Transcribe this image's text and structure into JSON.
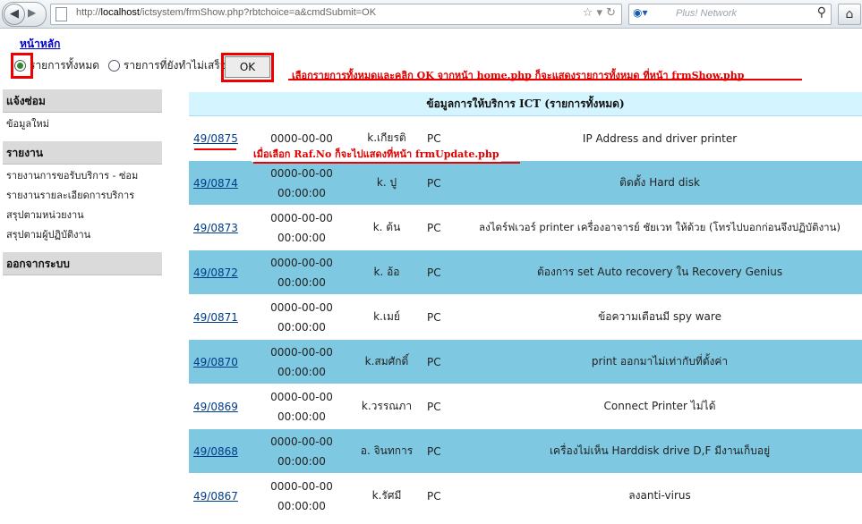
{
  "browser": {
    "url_prefix": "http://",
    "url_host": "localhost",
    "url_path": "/ictsystem/frmShow.php?rbtchoice=a&cmdSubmit=OK",
    "search_placeholder": "Plus! Network"
  },
  "header": {
    "home_link": "หน้าหลัก",
    "radio_all_label": "รายการทั้งหมด",
    "radio_pending_label": "รายการที่ยังทำไม่เสร็จ",
    "selected": "all",
    "ok_label": "OK"
  },
  "annotations": {
    "top_note": "เลือกรายการทั้งหมดและคลิก OK จากหน้า home.php ก็จะแสดงรายการทั้งหมด ที่หน้า frmShow.php",
    "ref_note": "เมื่อเลือก Raf.No ก็จะไปแสดงที่หน้า frmUpdate.php"
  },
  "sidebar": {
    "sections": [
      {
        "title": "แจ้งซ่อม",
        "items": [
          "ข้อมูลใหม่"
        ]
      },
      {
        "title": "รายงาน",
        "items": [
          "รายงานการขอรับบริการ - ซ่อม",
          "รายงานรายละเอียดการบริการ",
          "สรุปตามหน่วยงาน",
          "สรุปตามผู้ปฏิบัติงาน"
        ]
      },
      {
        "title": "ออกจากระบบ",
        "items": []
      }
    ]
  },
  "table": {
    "title": "ข้อมูลการให้บริการ ICT (รายการทั้งหมด)",
    "rows": [
      {
        "ref": "49/0875",
        "date": "0000-00-00",
        "time": "",
        "person": "k.เกียรติ",
        "cat": "PC",
        "desc": "IP Address and driver printer"
      },
      {
        "ref": "49/0874",
        "date": "0000-00-00",
        "time": "00:00:00",
        "person": "k. ปู",
        "cat": "PC",
        "desc": "ติดตั้ง Hard disk"
      },
      {
        "ref": "49/0873",
        "date": "0000-00-00",
        "time": "00:00:00",
        "person": "k. ต้น",
        "cat": "PC",
        "desc": "ลงไดร์ฟเวอร์ printer เครื่องอาจารย์ ชัยเวท ให้ด้วย (โทรไปบอกก่อนจึงปฏิบัติงาน)"
      },
      {
        "ref": "49/0872",
        "date": "0000-00-00",
        "time": "00:00:00",
        "person": "k. อ้อ",
        "cat": "PC",
        "desc": "ต้องการ set Auto recovery ใน Recovery Genius"
      },
      {
        "ref": "49/0871",
        "date": "0000-00-00",
        "time": "00:00:00",
        "person": "k.เมย์",
        "cat": "PC",
        "desc": "ข้อความเตือนมี spy ware"
      },
      {
        "ref": "49/0870",
        "date": "0000-00-00",
        "time": "00:00:00",
        "person": "k.สมศักดิ์",
        "cat": "PC",
        "desc": "print ออกมาไม่เท่ากับที่ตั้งค่า"
      },
      {
        "ref": "49/0869",
        "date": "0000-00-00",
        "time": "00:00:00",
        "person": "k.วรรณภา",
        "cat": "PC",
        "desc": "Connect Printer ไม่ได้"
      },
      {
        "ref": "49/0868",
        "date": "0000-00-00",
        "time": "00:00:00",
        "person": "อ. จินทการ",
        "cat": "PC",
        "desc": "เครื่องไม่เห็น Harddisk drive D,F มีงานเก็บอยู่"
      },
      {
        "ref": "49/0867",
        "date": "0000-00-00",
        "time": "00:00:00",
        "person": "k.รัศมี",
        "cat": "PC",
        "desc": "ลงanti-virus"
      }
    ]
  },
  "colors": {
    "row_alt": "#7ec8e1",
    "header_bg": "#d4f4ff",
    "annotation": "#e00000"
  }
}
